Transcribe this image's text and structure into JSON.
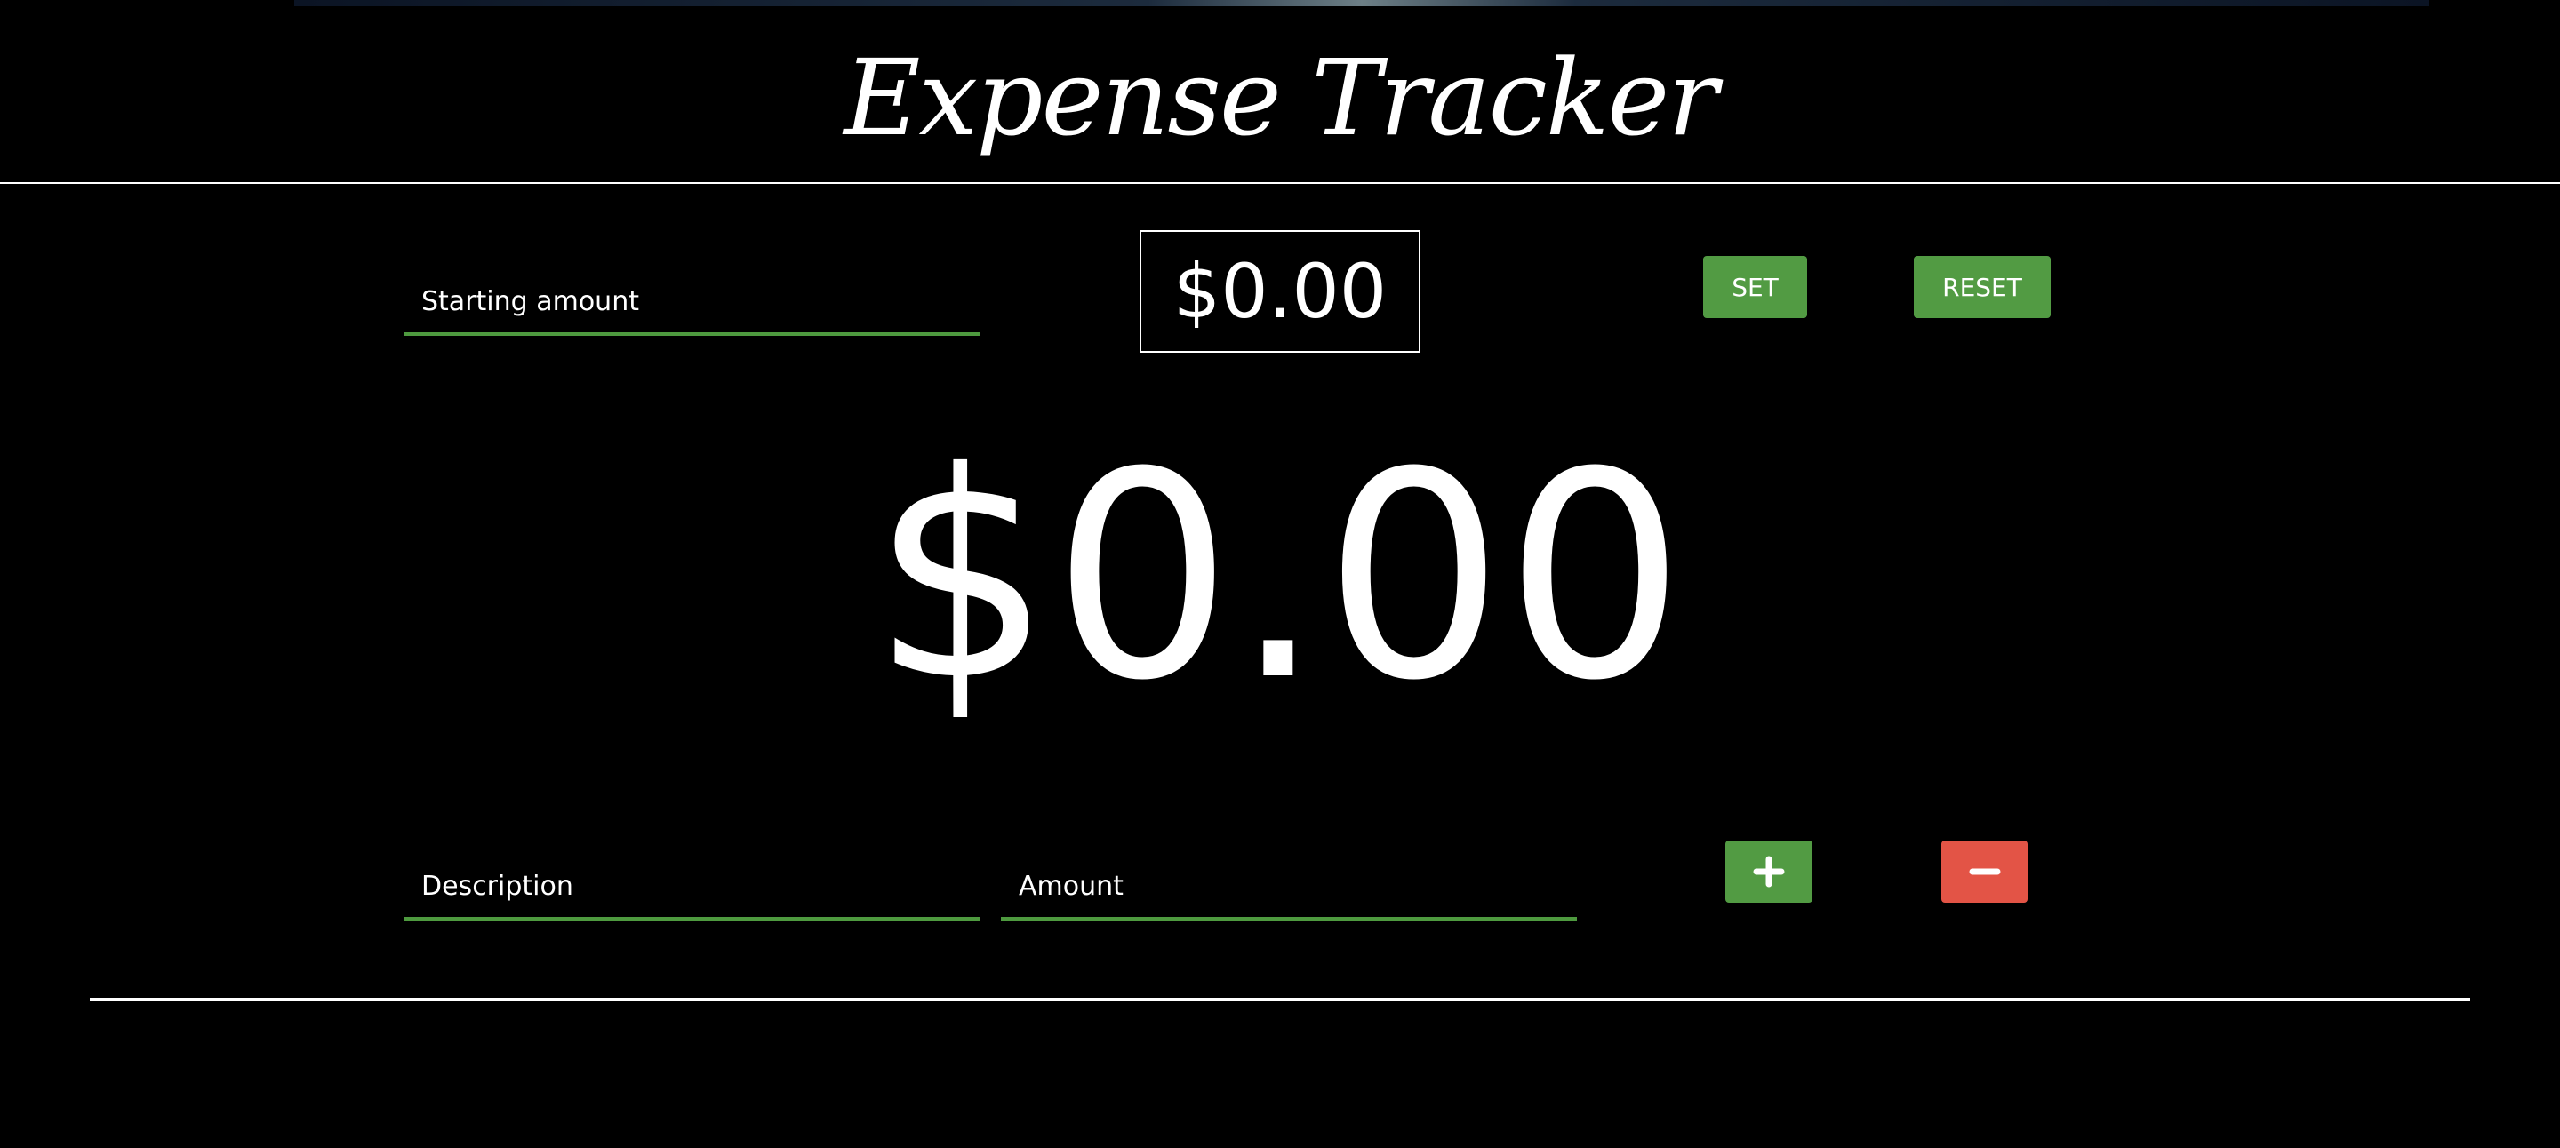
{
  "header": {
    "title": "Expense Tracker"
  },
  "starting": {
    "placeholder": "Starting amount",
    "value": "",
    "display": "$0.00",
    "set_label": "SET",
    "reset_label": "RESET"
  },
  "balance": {
    "display": "$0.00"
  },
  "entry": {
    "description_placeholder": "Description",
    "amount_placeholder": "Amount",
    "add_icon": "plus-icon",
    "subtract_icon": "minus-icon"
  },
  "colors": {
    "accent_green": "#529b43",
    "danger_red": "#e35446",
    "background": "#000000"
  }
}
